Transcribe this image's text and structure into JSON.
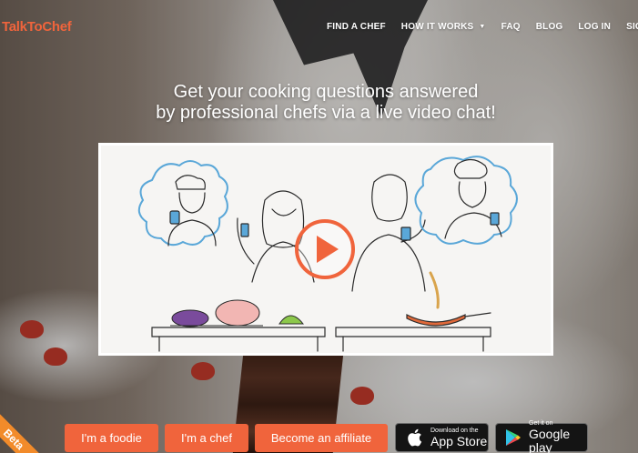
{
  "brand": {
    "logo_text": "TalkToChef",
    "accent_color": "#f0643c"
  },
  "nav": {
    "items": [
      {
        "label": "FIND A CHEF"
      },
      {
        "label": "HOW IT WORKS",
        "has_dropdown": true
      },
      {
        "label": "FAQ"
      },
      {
        "label": "BLOG"
      },
      {
        "label": "LOG IN"
      },
      {
        "label": "SIGN U"
      }
    ]
  },
  "hero": {
    "headline_line1": "Get your cooking questions answered",
    "headline_line2": "by professional chefs via a live video chat!",
    "video_play_icon": "play-icon"
  },
  "cta": {
    "foodie": "I'm a foodie",
    "chef": "I'm a chef",
    "affiliate": "Become an affiliate"
  },
  "app_store": {
    "small": "Download on the",
    "big": "App Store",
    "icon": "apple-icon"
  },
  "google_play": {
    "small": "Get it on",
    "big": "Google play",
    "icon": "google-play-icon"
  },
  "beta_ribbon": "Beta"
}
